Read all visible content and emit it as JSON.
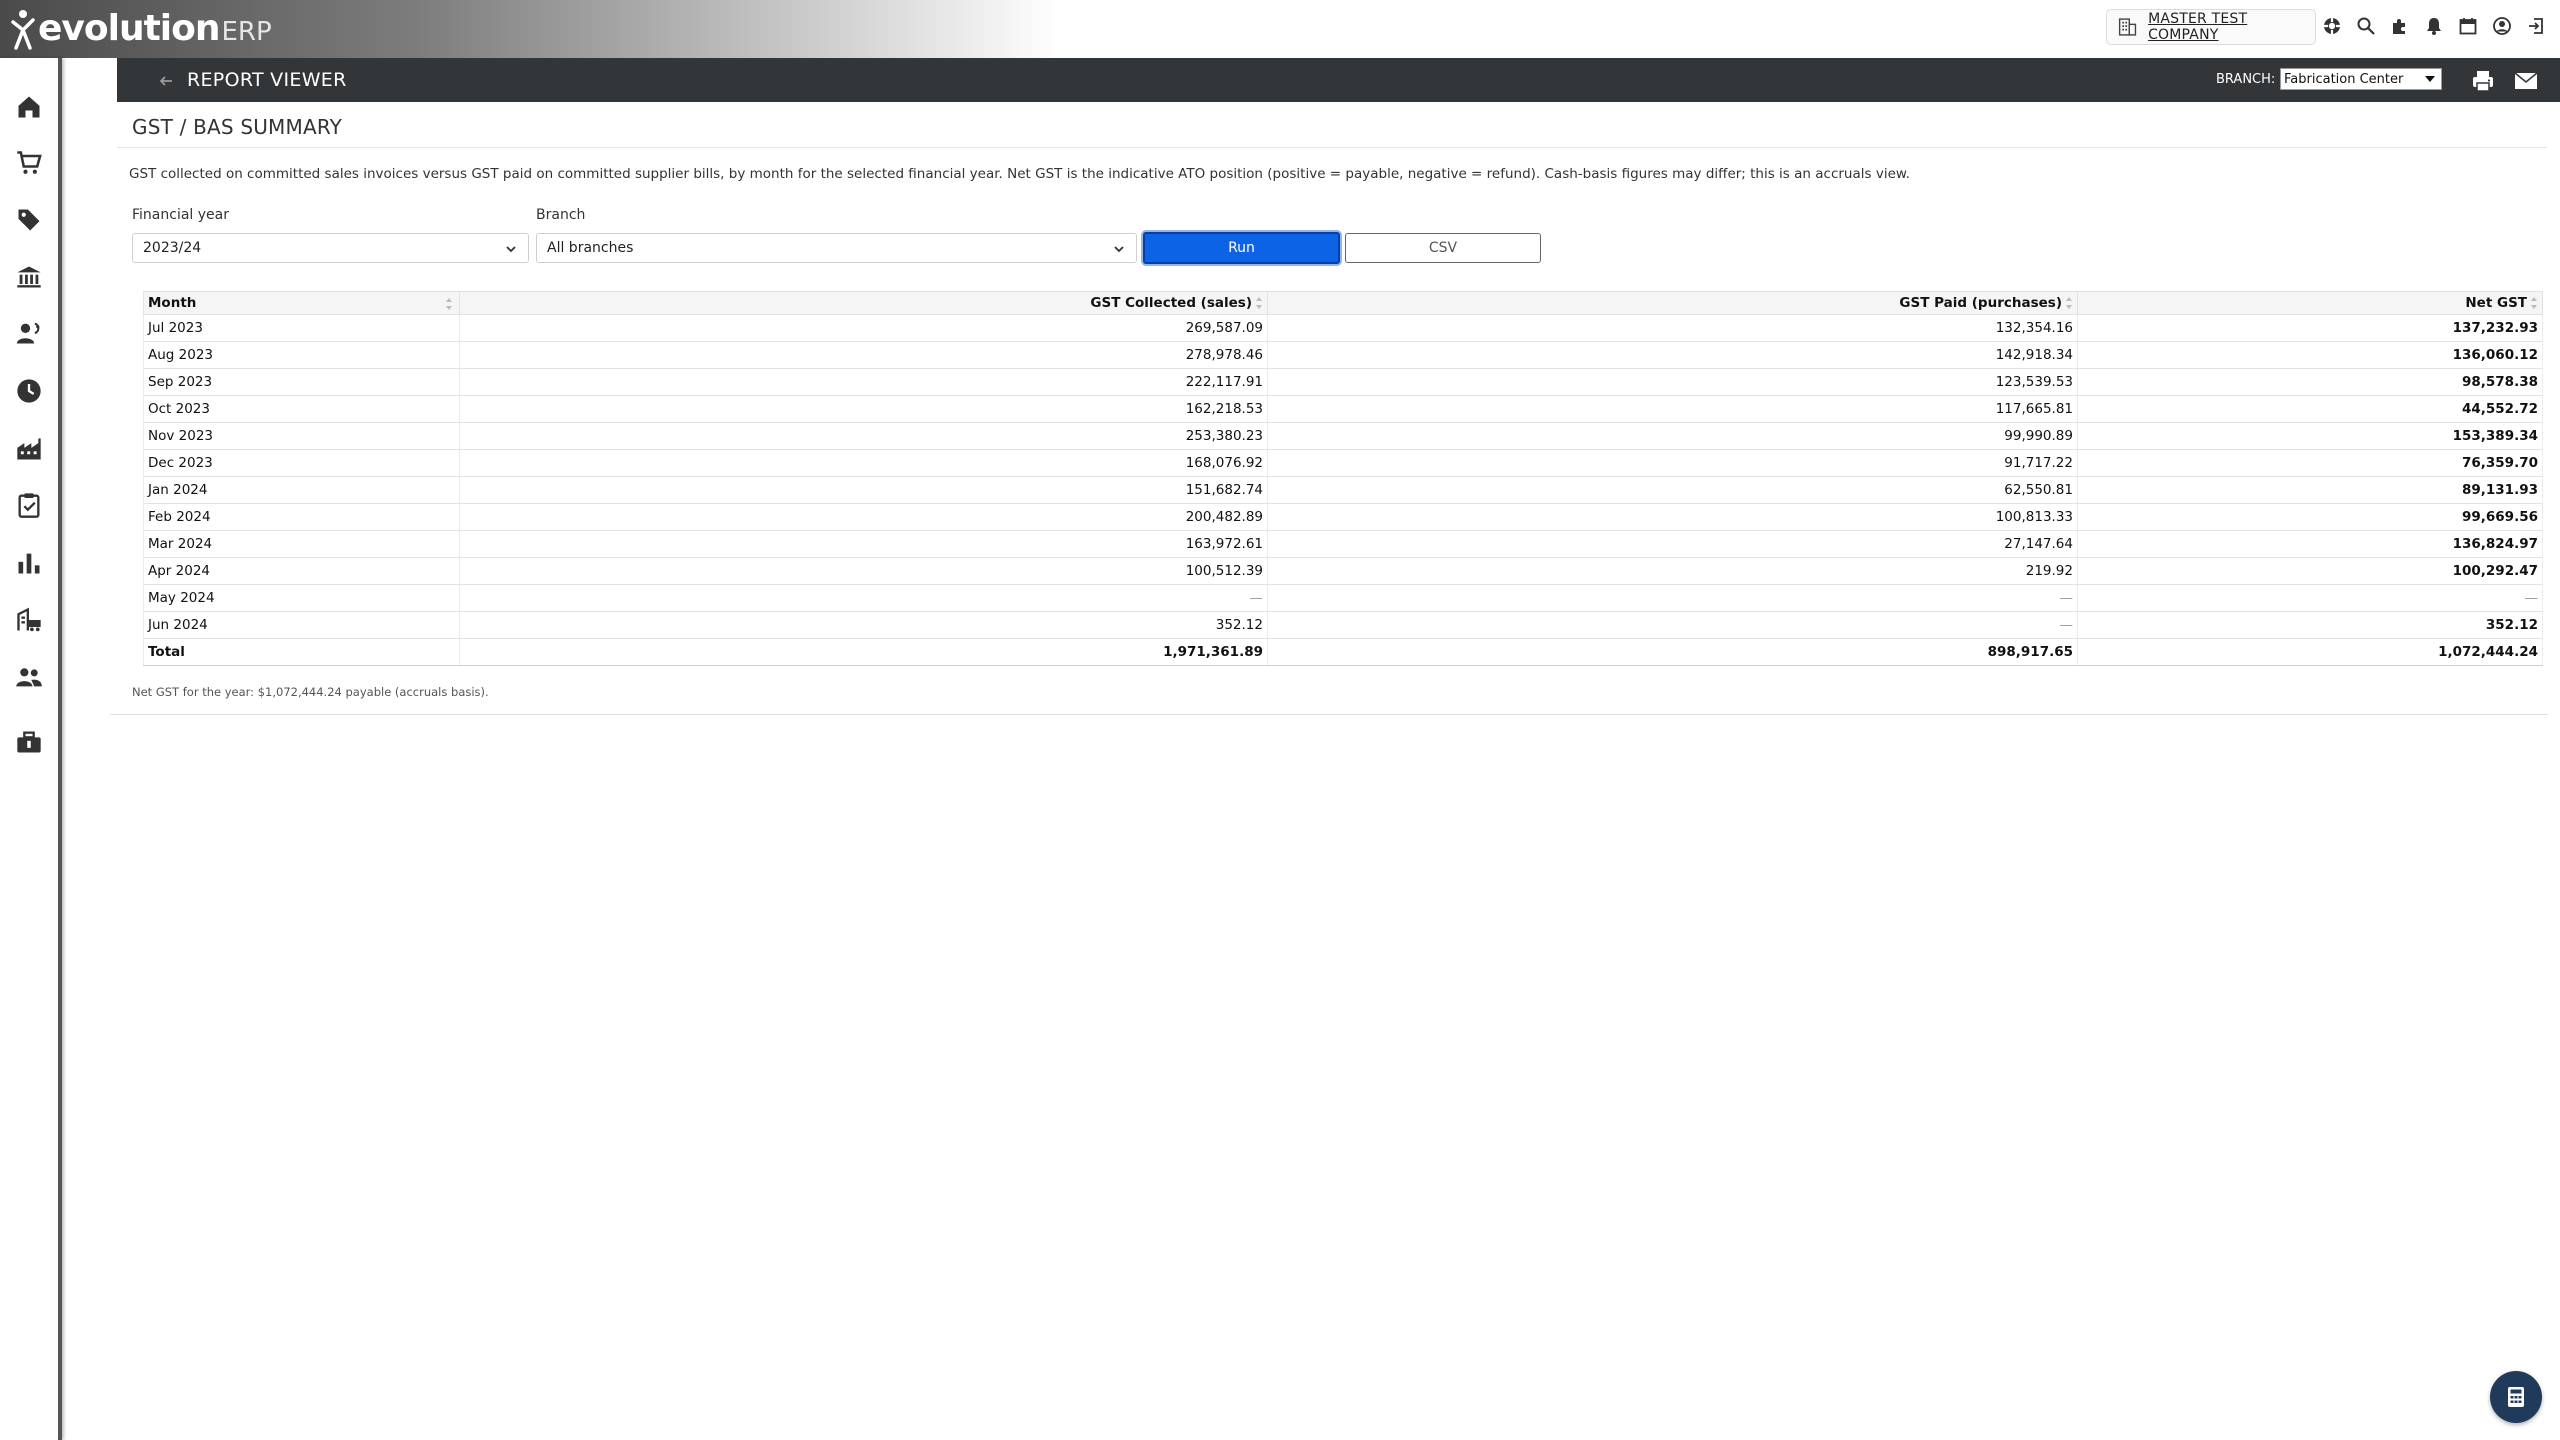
{
  "brand": {
    "word": "evolution",
    "suffix": "ERP"
  },
  "header": {
    "company": "MASTER TEST COMPANY",
    "icons": [
      "support-icon",
      "search-icon",
      "extensions-icon",
      "notifications-icon",
      "calendar-icon",
      "account-icon",
      "logout-icon"
    ]
  },
  "sidebar": {
    "items": [
      "home-icon",
      "cart-icon",
      "tag-icon",
      "bank-icon",
      "customer-service-icon",
      "clock-icon",
      "factory-icon",
      "clipboard-check-icon",
      "bar-chart-icon",
      "warehouse-transport-icon",
      "people-icon",
      "toolbox-icon"
    ]
  },
  "report_bar": {
    "title": "REPORT VIEWER",
    "branch_label": "BRANCH:",
    "branch_value": "Fabrication Center"
  },
  "page": {
    "title": "GST / BAS SUMMARY",
    "description": "GST collected on committed sales invoices versus GST paid on committed supplier bills, by month for the selected financial year. Net GST is the indicative ATO position (positive = payable, negative = refund). Cash-basis figures may differ; this is an accruals view.",
    "filters": {
      "financial_year_label": "Financial year",
      "financial_year_value": "2023/24",
      "branch_label": "Branch",
      "branch_value": "All branches"
    },
    "run_label": "Run",
    "csv_label": "CSV",
    "footnote": "Net GST for the year: $1,072,444.24 payable (accruals basis)."
  },
  "table": {
    "columns": [
      "Month",
      "GST Collected (sales)",
      "GST Paid (purchases)",
      "Net GST"
    ],
    "rows": [
      [
        "Jul 2023",
        "269,587.09",
        "132,354.16",
        "137,232.93"
      ],
      [
        "Aug 2023",
        "278,978.46",
        "142,918.34",
        "136,060.12"
      ],
      [
        "Sep 2023",
        "222,117.91",
        "123,539.53",
        "98,578.38"
      ],
      [
        "Oct 2023",
        "162,218.53",
        "117,665.81",
        "44,552.72"
      ],
      [
        "Nov 2023",
        "253,380.23",
        "99,990.89",
        "153,389.34"
      ],
      [
        "Dec 2023",
        "168,076.92",
        "91,717.22",
        "76,359.70"
      ],
      [
        "Jan 2024",
        "151,682.74",
        "62,550.81",
        "89,131.93"
      ],
      [
        "Feb 2024",
        "200,482.89",
        "100,813.33",
        "99,669.56"
      ],
      [
        "Mar 2024",
        "163,972.61",
        "27,147.64",
        "136,824.97"
      ],
      [
        "Apr 2024",
        "100,512.39",
        "219.92",
        "100,292.47"
      ],
      [
        "May 2024",
        "—",
        "—",
        "—"
      ],
      [
        "Jun 2024",
        "352.12",
        "—",
        "352.12"
      ]
    ],
    "total": [
      "Total",
      "1,971,361.89",
      "898,917.65",
      "1,072,444.24"
    ]
  }
}
